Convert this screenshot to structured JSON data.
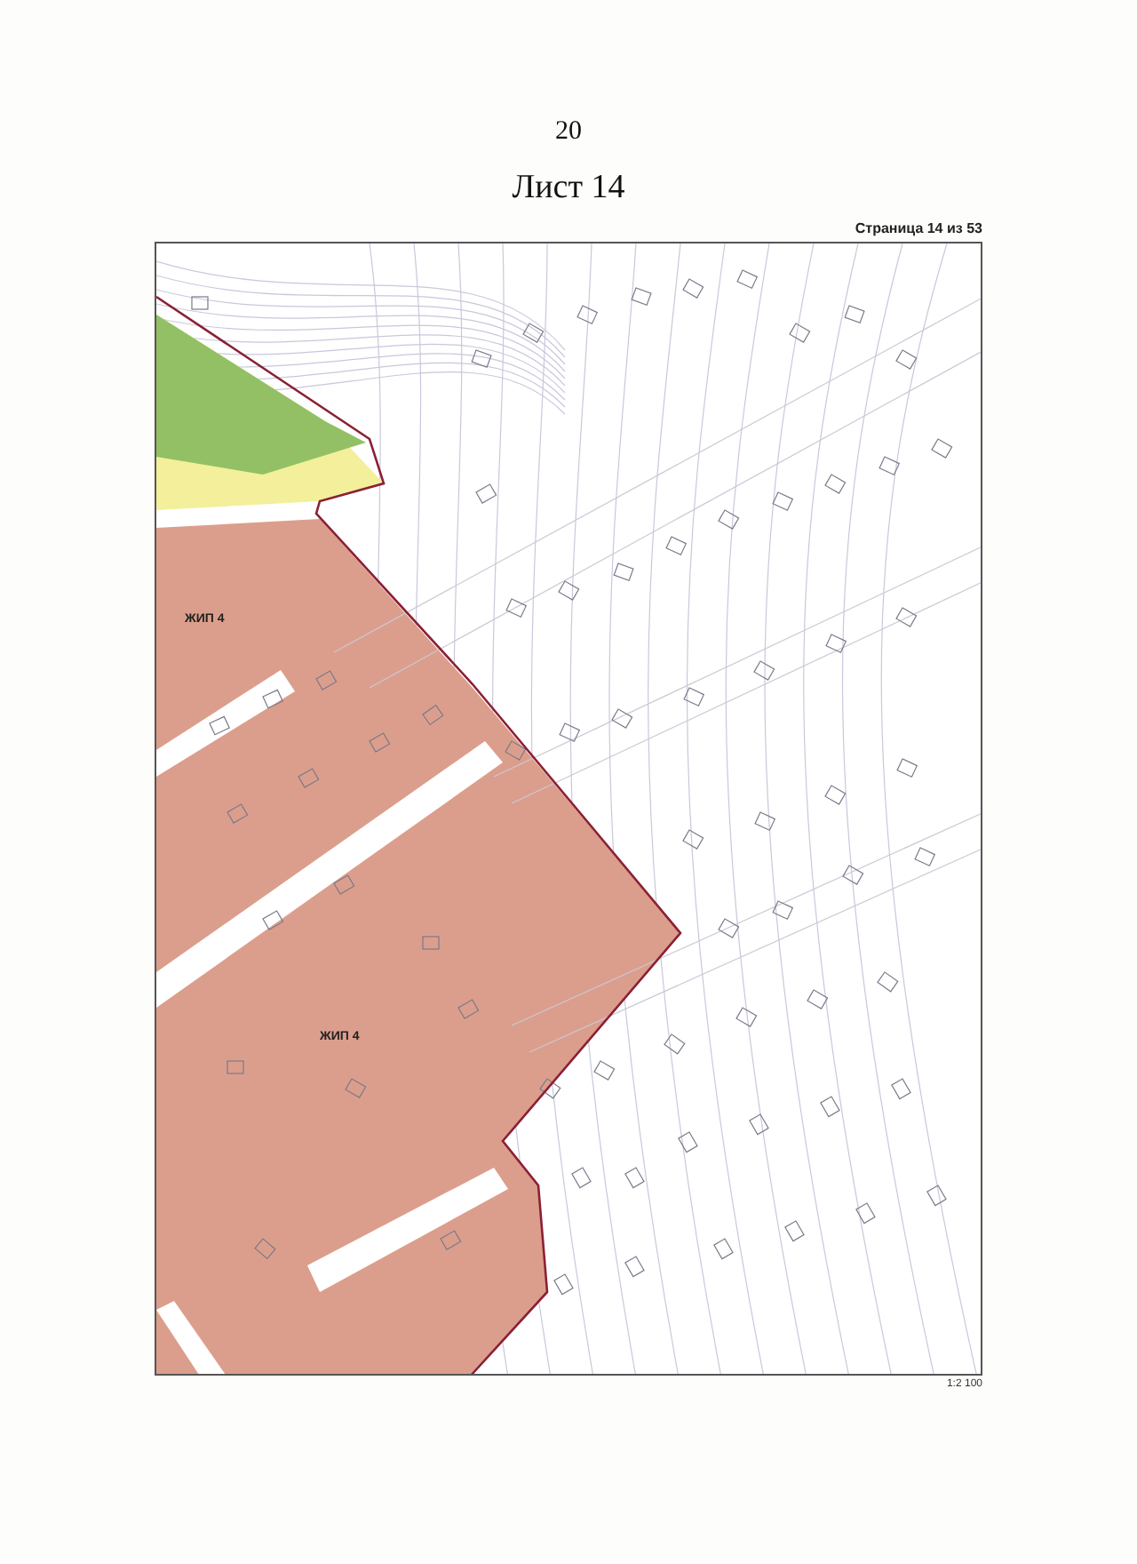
{
  "page_number": "20",
  "sheet_title": "Лист 14",
  "page_counter": "Страница 14 из 53",
  "map": {
    "zone_labels": [
      "ЖИП 4",
      "ЖИП 4"
    ],
    "scale": "1:2 100"
  }
}
